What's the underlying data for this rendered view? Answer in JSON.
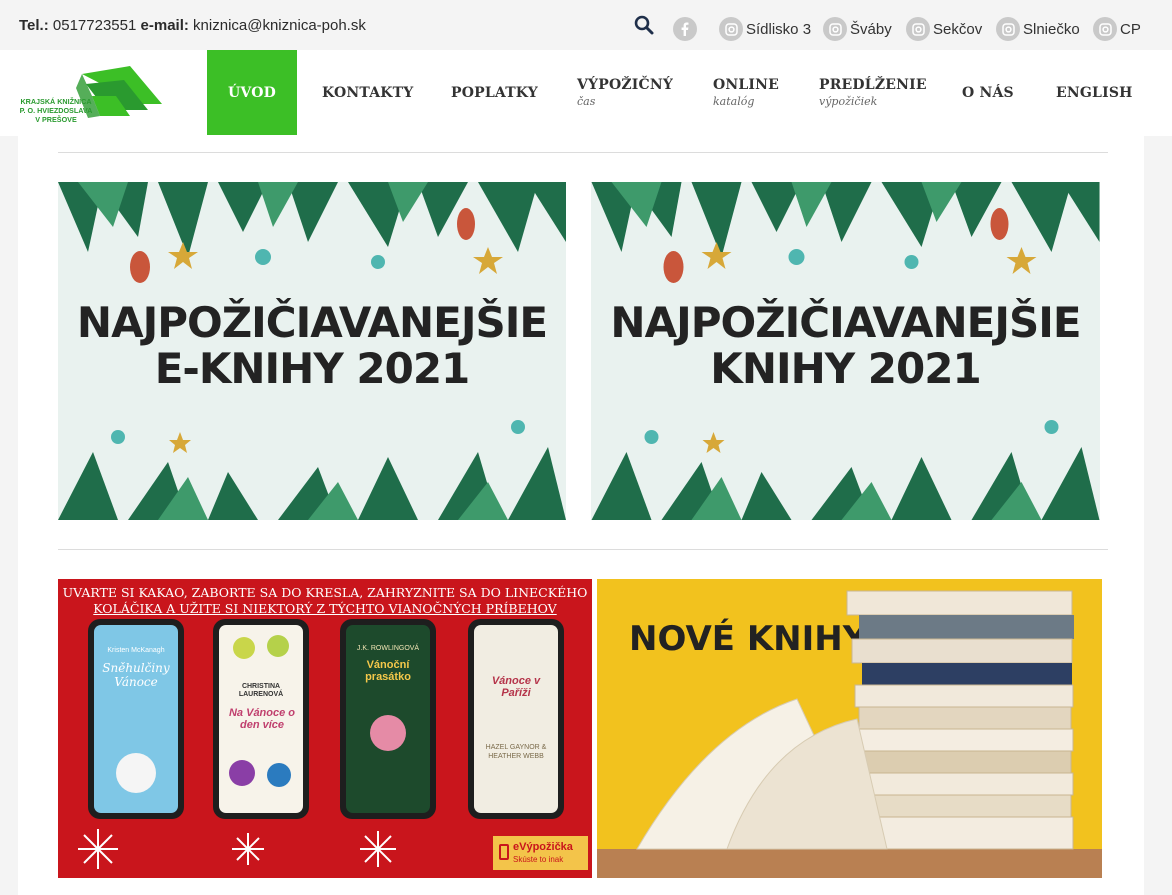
{
  "topbar": {
    "tel_label": "Tel.:",
    "tel_value": "0517723551",
    "email_label": "e-mail:",
    "email_value": "kniznica@kniznica-poh.sk",
    "socials": [
      "Sídlisko 3",
      "Šváby",
      "Sekčov",
      "Slniečko",
      "CP"
    ]
  },
  "logo": {
    "line1": "KRAJSKÁ KNIŽNICA",
    "line2": "P. O. HVIEZDOSLAVA",
    "line3": "V PREŠOVE"
  },
  "nav": {
    "uvod": "ÚVOD",
    "kontakty": "KONTAKTY",
    "poplatky": "POPLATKY",
    "vypozicny": "VÝPOŽIČNÝ",
    "vypozicny_sub": "čas",
    "online": "ONLINE",
    "online_sub": "katalóg",
    "predlzenie": "PREDĹŽENIE",
    "predlzenie_sub": "výpožičiek",
    "onas": "O NÁS",
    "english": "ENGLISH"
  },
  "banners": {
    "ebooks_line1": "NAJPOŽIČIAVANEJŠIE",
    "ebooks_line2": "E-KNIHY 2021",
    "books_line1": "NAJPOŽIČIAVANEJŠIE",
    "books_line2": "KNIHY 2021",
    "red_line1": "UVARTE SI KAKAO, ZABORTE SA DO KRESLA, ZAHRYZNITE SA DO LINECKÉHO",
    "red_line2": "KOLÁČIKA A UŽITE SI NIEKTORÝ Z TÝCHTO VIANOČNÝCH PRÍBEHOV",
    "book1_author": "Kristen McKanagh",
    "book1_title": "Sněhulčiny Vánoce",
    "book2_author": "CHRISTINA LAURENOVÁ",
    "book2_title": "Na Vánoce o den více",
    "book3_author": "J.K. ROWLINGOVÁ",
    "book3_title": "Vánoční prasátko",
    "book4_title": "Vánoce v Paříži",
    "book4_author": "HAZEL GAYNOR & HEATHER WEBB",
    "evyp_title": "eVýpožička",
    "evyp_sub": "Skúste to inak",
    "nove": "NOVÉ KNIHY"
  },
  "colors": {
    "accent_green": "#3cbf26",
    "logo_green": "#2a9a2f",
    "red_banner": "#c9151c",
    "yellow_banner": "#f2c21e"
  }
}
